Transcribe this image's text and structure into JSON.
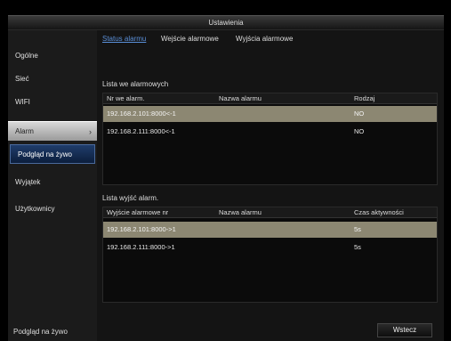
{
  "window": {
    "title": "Ustawienia"
  },
  "sidebar": {
    "items": [
      {
        "label": "Ogólne"
      },
      {
        "label": "Sieć"
      },
      {
        "label": "WIFI"
      },
      {
        "label": "Alarm",
        "chevron": "›"
      },
      {
        "label": "Podgląd na żywo"
      },
      {
        "label": "Wyjątek"
      },
      {
        "label": "Użytkownicy"
      }
    ],
    "bottom_label": "Podgląd na żywo"
  },
  "tabs": [
    {
      "label": "Status alarmu"
    },
    {
      "label": "Wejście alarmowe"
    },
    {
      "label": "Wyjścia alarmowe"
    }
  ],
  "inputs_section": {
    "label": "Lista we alarmowych",
    "headers": [
      "Nr we alarm.",
      "Nazwa alarmu",
      "Rodzaj"
    ],
    "rows": [
      {
        "nr": "192.168.2.101:8000<-1",
        "name": "",
        "type": "NO"
      },
      {
        "nr": "192.168.2.111:8000<-1",
        "name": "",
        "type": "NO"
      }
    ]
  },
  "outputs_section": {
    "label": "Lista wyjść alarm.",
    "headers": [
      "Wyjście alarmowe nr",
      "Nazwa alarmu",
      "Czas aktywności"
    ],
    "rows": [
      {
        "nr": "192.168.2.101:8000->1",
        "name": "",
        "time": "5s"
      },
      {
        "nr": "192.168.2.111:8000->1",
        "name": "",
        "time": "5s"
      }
    ]
  },
  "footer": {
    "back_label": "Wstecz"
  },
  "colors": {
    "selected_row": "#8c8772",
    "tab_active": "#5a8fd8",
    "live_view": "#1f3d6b"
  }
}
